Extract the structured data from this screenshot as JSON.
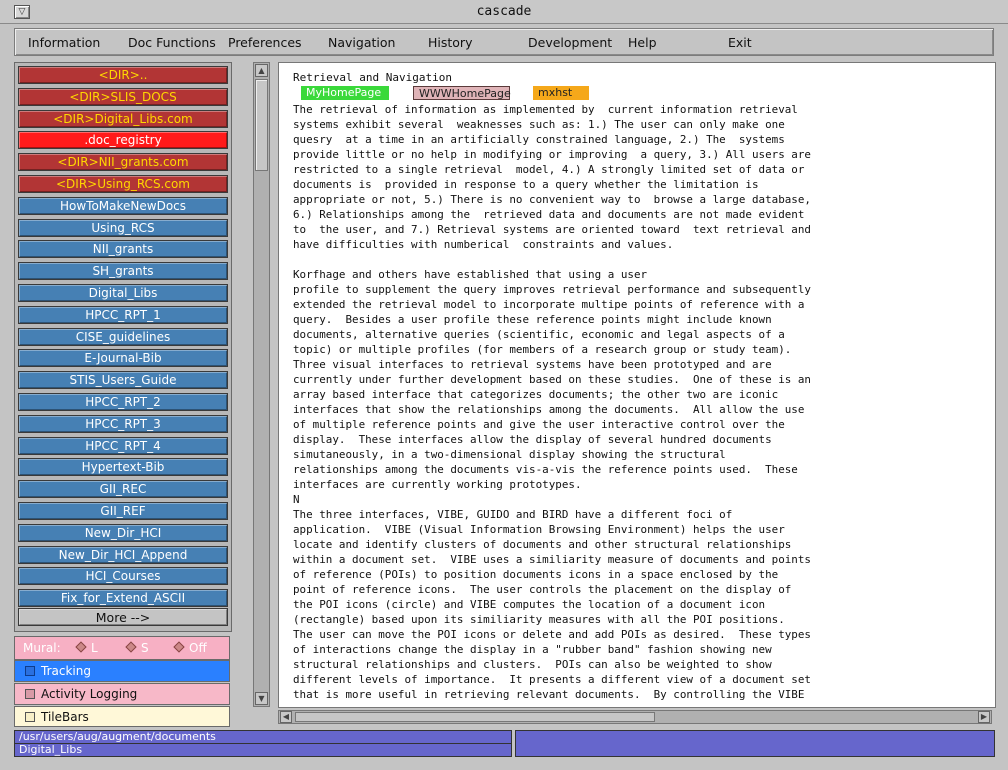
{
  "window": {
    "title": "cascade"
  },
  "menu": [
    "Information",
    "Doc Functions",
    "Preferences",
    "Navigation",
    "History",
    "Development",
    "Help",
    "Exit"
  ],
  "nav": {
    "items": [
      {
        "label": "<DIR>..",
        "type": "dir"
      },
      {
        "label": "<DIR>SLIS_DOCS",
        "type": "dir"
      },
      {
        "label": "<DIR>Digital_Libs.com",
        "type": "dir"
      },
      {
        "label": ".doc_registry",
        "type": "selected"
      },
      {
        "label": "<DIR>NII_grants.com",
        "type": "dir"
      },
      {
        "label": "<DIR>Using_RCS.com",
        "type": "dir"
      },
      {
        "label": "HowToMakeNewDocs",
        "type": "doc"
      },
      {
        "label": "Using_RCS",
        "type": "doc"
      },
      {
        "label": "NII_grants",
        "type": "doc"
      },
      {
        "label": "SH_grants",
        "type": "doc"
      },
      {
        "label": "Digital_Libs",
        "type": "doc"
      },
      {
        "label": "HPCC_RPT_1",
        "type": "doc"
      },
      {
        "label": "CISE_guidelines",
        "type": "doc"
      },
      {
        "label": "E-Journal-Bib",
        "type": "doc"
      },
      {
        "label": "STIS_Users_Guide",
        "type": "doc"
      },
      {
        "label": "HPCC_RPT_2",
        "type": "doc"
      },
      {
        "label": "HPCC_RPT_3",
        "type": "doc"
      },
      {
        "label": "HPCC_RPT_4",
        "type": "doc"
      },
      {
        "label": "Hypertext-Bib",
        "type": "doc"
      },
      {
        "label": "GII_REC",
        "type": "doc"
      },
      {
        "label": "GII_REF",
        "type": "doc"
      },
      {
        "label": "New_Dir_HCI",
        "type": "doc"
      },
      {
        "label": "New_Dir_HCI_Append",
        "type": "doc"
      },
      {
        "label": "HCI_Courses",
        "type": "doc"
      },
      {
        "label": "Fix_for_Extend_ASCII",
        "type": "doc"
      }
    ],
    "more_label": "More -->"
  },
  "mural": {
    "label": "Mural:",
    "options": [
      "L",
      "S",
      "Off"
    ]
  },
  "toggles": {
    "tracking": "Tracking",
    "logging": "Activity Logging",
    "tilebars": "TileBars"
  },
  "doc": {
    "heading": "Retrieval and Navigation",
    "links": {
      "home": "MyHomePage",
      "www": "WWWHomePage",
      "mxhst": "mxhst"
    },
    "body": "The retrieval of information as implemented by  current information retrieval\nsystems exhibit several  weaknesses such as: 1.) The user can only make one\nquesry  at a time in an artificially constrained language, 2.) The  systems\nprovide little or no help in modifying or improving  a query, 3.) All users are\nrestricted to a single retrieval  model, 4.) A strongly limited set of data or\ndocuments is  provided in response to a query whether the limitation is\nappropriate or not, 5.) There is no convenient way to  browse a large database,\n6.) Relationships among the  retrieved data and documents are not made evident\nto  the user, and 7.) Retrieval systems are oriented toward  text retrieval and\nhave difficulties with numberical  constraints and values.\n\nKorfhage and others have established that using a user\nprofile to supplement the query improves retrieval performance and subsequently\nextended the retrieval model to incorporate multipe points of reference with a\nquery.  Besides a user profile these reference points might include known\ndocuments, alternative queries (scientific, economic and legal aspects of a\ntopic) or multiple profiles (for members of a research group or study team).\nThree visual interfaces to retrieval systems have been prototyped and are\ncurrently under further development based on these studies.  One of these is an\narray based interface that categorizes documents; the other two are iconic\ninterfaces that show the relationships among the documents.  All allow the use\nof multiple reference points and give the user interactive control over the\ndisplay.  These interfaces allow the display of several hundred documents\nsimutaneously, in a two-dimensional display showing the structural\nrelationships among the documents vis-a-vis the reference points used.  These\ninterfaces are currently working prototypes.\nN\nThe three interfaces, VIBE, GUIDO and BIRD have a different foci of\napplication.  VIBE (Visual Information Browsing Environment) helps the user\nlocate and identify clusters of documents and other structural relationships\nwithin a document set.  VIBE uses a similiarity measure of documents and points\nof reference (POIs) to position documents icons in a space enclosed by the\npoint of reference icons.  The user controls the placement on the display of\nthe POI icons (circle) and VIBE computes the location of a document icon\n(rectangle) based upon its similiarity measures with all the POI positions.\nThe user can move the POI icons or delete and add POIs as desired.  These types\nof interactions change the display in a \"rubber band\" fashion showing new\nstructural relationships and clusters.  POIs can also be weighted to show\ndifferent levels of importance.  It presents a different view of a document set\nthat is more useful in retrieving relevant documents.  By controlling the VIBE"
  },
  "status": {
    "path": "/usr/users/aug/augment/documents",
    "doc": "Digital_Libs"
  }
}
